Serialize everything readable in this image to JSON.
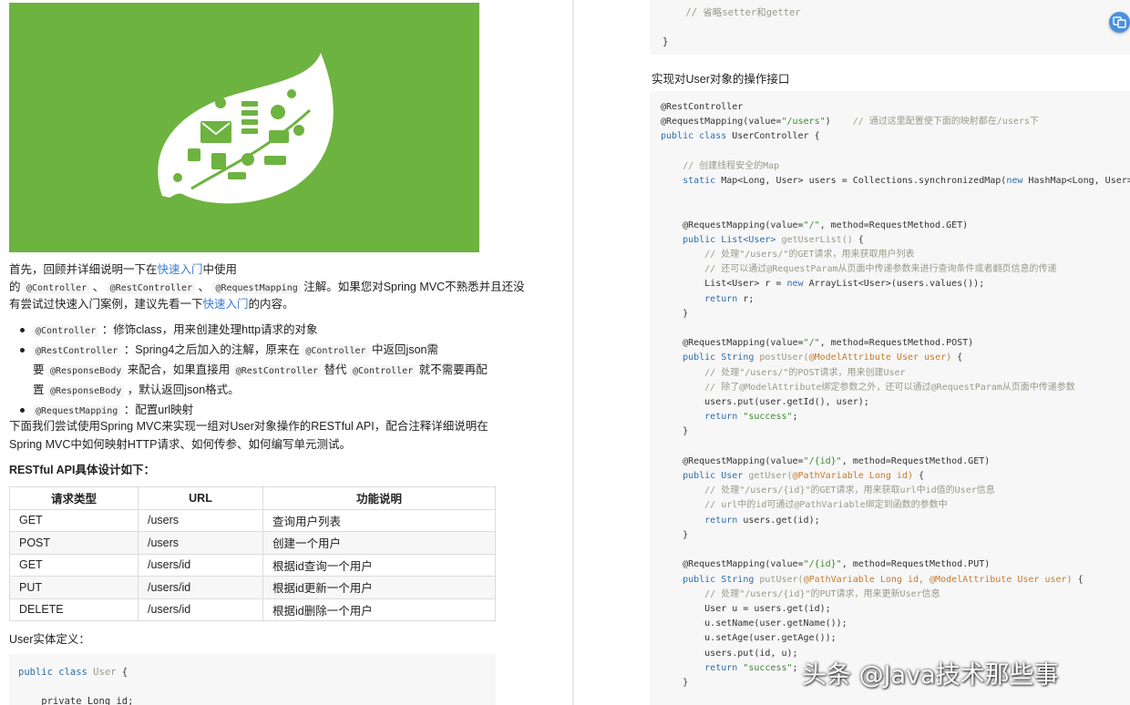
{
  "left": {
    "intro": {
      "l1_a": "首先，回顾并详细说明一下在",
      "l1_link": "快速入门",
      "l1_b": "中使用",
      "l2_a": "的 ",
      "l2_c1": "@Controller",
      "l2_sep1": " 、 ",
      "l2_c2": "@RestController",
      "l2_sep2": " 、 ",
      "l2_c3": "@RequestMapping",
      "l2_b": " 注解。如果您对Spring MVC不熟悉并且还没",
      "l3_a": "有尝试过快速入门案例，建议先看一下",
      "l3_link": "快速入门",
      "l3_b": "的内容。"
    },
    "bullets": {
      "b1_code": "@Controller",
      "b1_text": " ：修饰class，用来创建处理http请求的对象",
      "b2_code": "@RestController",
      "b2_text1": " ：Spring4之后加入的注解，原来在 ",
      "b2_code2": "@Controller",
      "b2_text2": " 中返回json需",
      "b2_l2_a": "要 ",
      "b2_l2_code1": "@ResponseBody",
      "b2_l2_b": " 来配合，如果直接用 ",
      "b2_l2_code2": "@RestController",
      "b2_l2_c": " 替代 ",
      "b2_l2_code3": "@Controller",
      "b2_l2_d": " 就不需要再配",
      "b2_l3_a": "置 ",
      "b2_l3_code": "@ResponseBody",
      "b2_l3_b": " ，默认返回json格式。",
      "b3_code": "@RequestMapping",
      "b3_text": " ：配置url映射"
    },
    "body1": "下面我们尝试使用Spring MVC来实现一组对User对象操作的RESTful API，配合注释详细说明在",
    "body2": "Spring MVC中如何映射HTTP请求、如何传参、如何编写单元测试。",
    "api_heading": "RESTful API具体设计如下：",
    "table": {
      "headers": [
        "请求类型",
        "URL",
        "功能说明"
      ],
      "rows": [
        [
          "GET",
          "/users",
          "查询用户列表"
        ],
        [
          "POST",
          "/users",
          "创建一个用户"
        ],
        [
          "GET",
          "/users/id",
          "根据id查询一个用户"
        ],
        [
          "PUT",
          "/users/id",
          "根据id更新一个用户"
        ],
        [
          "DELETE",
          "/users/id",
          "根据id删除一个用户"
        ]
      ]
    },
    "entity_heading": "User实体定义：",
    "user_code": {
      "l1_kw": "public class",
      "l1_name": " User",
      "l1_rest": " {",
      "l2": "    private Long id;"
    }
  },
  "right": {
    "top_code": {
      "comment": "    // 省略setter和getter",
      "close": "}"
    },
    "heading": "实现对User对象的操作接口",
    "code": {
      "a01": "@RestController",
      "a02a": "@RequestMapping(value=",
      "a02s": "\"/users\"",
      "a02b": ")",
      "a02c": "    // 通过这里配置使下面的映射都在/users下",
      "a03k": "public class",
      "a03b": " UserController {",
      "c01": "    // 创建线程安全的Map",
      "a05k": "    static",
      "a05b": " Map<Long, User> users = Collections.synchronizedMap(",
      "a05n": "new",
      "a05c": " HashMap<Long, User>());",
      "m1a": "    @RequestMapping(value=",
      "m1s": "\"/\"",
      "m1b": ", method=RequestMethod.GET)",
      "m1k": "    public",
      "m1t": " List<User>",
      "m1n": " getUserList()",
      "m1e": " {",
      "m1c1": "        // 处理\"/users/\"的GET请求，用来获取用户列表",
      "m1c2": "        // 还可以通过@RequestParam从页面中传递参数来进行查询条件或者翻页信息的传递",
      "m1l1a": "        List<User> r = ",
      "m1l1n": "new",
      "m1l1b": " ArrayList<User>(users.values());",
      "m1l2k": "        return",
      "m1l2b": " r;",
      "close4": "    }",
      "m2a": "    @RequestMapping(value=",
      "m2s": "\"/\"",
      "m2b": ", method=RequestMethod.POST)",
      "m2k": "    public",
      "m2t": " String",
      "m2n": " postUser(",
      "m2an": "@ModelAttribute User user)",
      "m2e": " {",
      "m2c1": "        // 处理\"/users/\"的POST请求，用来创建User",
      "m2c2": "        // 除了@ModelAttribute绑定参数之外，还可以通过@RequestParam从页面中传递参数",
      "m2l1": "        users.put(user.getId(), user);",
      "m2l2k": "        return",
      "m2l2s": " \"success\"",
      "m2l2e": ";",
      "m3a": "    @RequestMapping(value=",
      "m3s": "\"/{id}\"",
      "m3b": ", method=RequestMethod.GET)",
      "m3k": "    public",
      "m3t": " User",
      "m3n": " getUser(",
      "m3an": "@PathVariable Long id)",
      "m3e": " {",
      "m3c1": "        // 处理\"/users/{id}\"的GET请求，用来获取url中id值的User信息",
      "m3c2": "        // url中的id可通过@PathVariable绑定到函数的参数中",
      "m3l1k": "        return",
      "m3l1b": " users.get(id);",
      "m4a": "    @RequestMapping(value=",
      "m4s": "\"/{id}\"",
      "m4b": ", method=RequestMethod.PUT)",
      "m4k": "    public",
      "m4t": " String",
      "m4n": " putUser(",
      "m4an": "@PathVariable Long id, @ModelAttribute User user)",
      "m4e": " {",
      "m4c1": "        // 处理\"/users/{id}\"的PUT请求，用来更新User信息",
      "m4l1": "        User u = users.get(id);",
      "m4l2": "        u.setName(user.getName());",
      "m4l3": "        u.setAge(user.getAge());",
      "m4l4": "        users.put(id, u);",
      "m4l5k": "        return",
      "m4l5s": " \"success\"",
      "m4l5e": ";"
    }
  },
  "watermark": "头条 @Java技术那些事",
  "colors": {
    "hero": "#6db33f",
    "link": "#3a7bd5",
    "float_button": "#4a90e2"
  },
  "icons": {
    "hero": "spring-leaf-icon",
    "float_button": "translate-icon"
  }
}
